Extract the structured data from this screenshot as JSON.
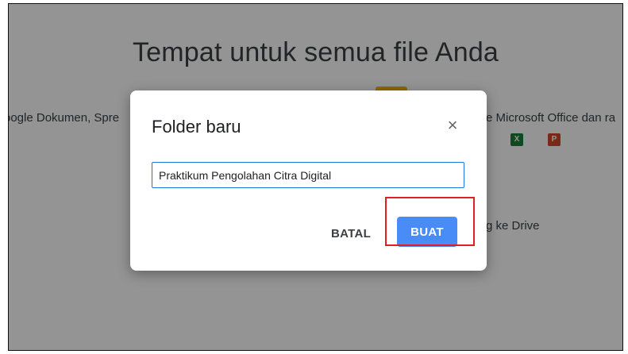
{
  "background": {
    "heading": "Tempat untuk semua file Anda",
    "left_text": "oogle Dokumen, Spre",
    "right_text": "e Microsoft Office dan ra",
    "drag_text": "g ke Drive",
    "excel_letter": "X",
    "ppt_letter": "P"
  },
  "dialog": {
    "title": "Folder baru",
    "close_label": "×",
    "folder_name_value": "Praktikum Pengolahan Citra Digital",
    "cancel_label": "BATAL",
    "create_label": "BUAT"
  },
  "colors": {
    "primary_button": "#4a8cf7",
    "highlight_box": "#e02020",
    "input_border": "#1a73e8"
  }
}
